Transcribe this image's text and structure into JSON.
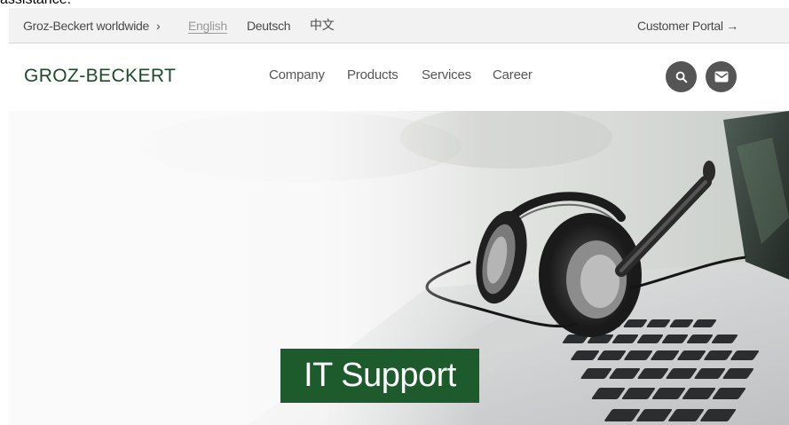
{
  "top_clipped_text": "assistance.",
  "topbar": {
    "worldwide": "Groz-Beckert worldwide",
    "chevron": "›",
    "languages": [
      "English",
      "Deutsch",
      "中文"
    ],
    "customer_portal": "Customer Portal",
    "customer_portal_arrow": "→"
  },
  "header": {
    "logo": "GROZ-BECKERT",
    "nav": [
      "Company",
      "Products",
      "Services",
      "Career"
    ],
    "icons": [
      "search-icon",
      "mail-icon"
    ]
  },
  "hero": {
    "title": "IT Support",
    "image": "headset-on-laptop",
    "badge_color": "#1d5a2c"
  },
  "colors": {
    "brand_green": "#1d4a2b",
    "topbar_bg": "#f2f2f2",
    "icon_button_bg": "#555555"
  }
}
